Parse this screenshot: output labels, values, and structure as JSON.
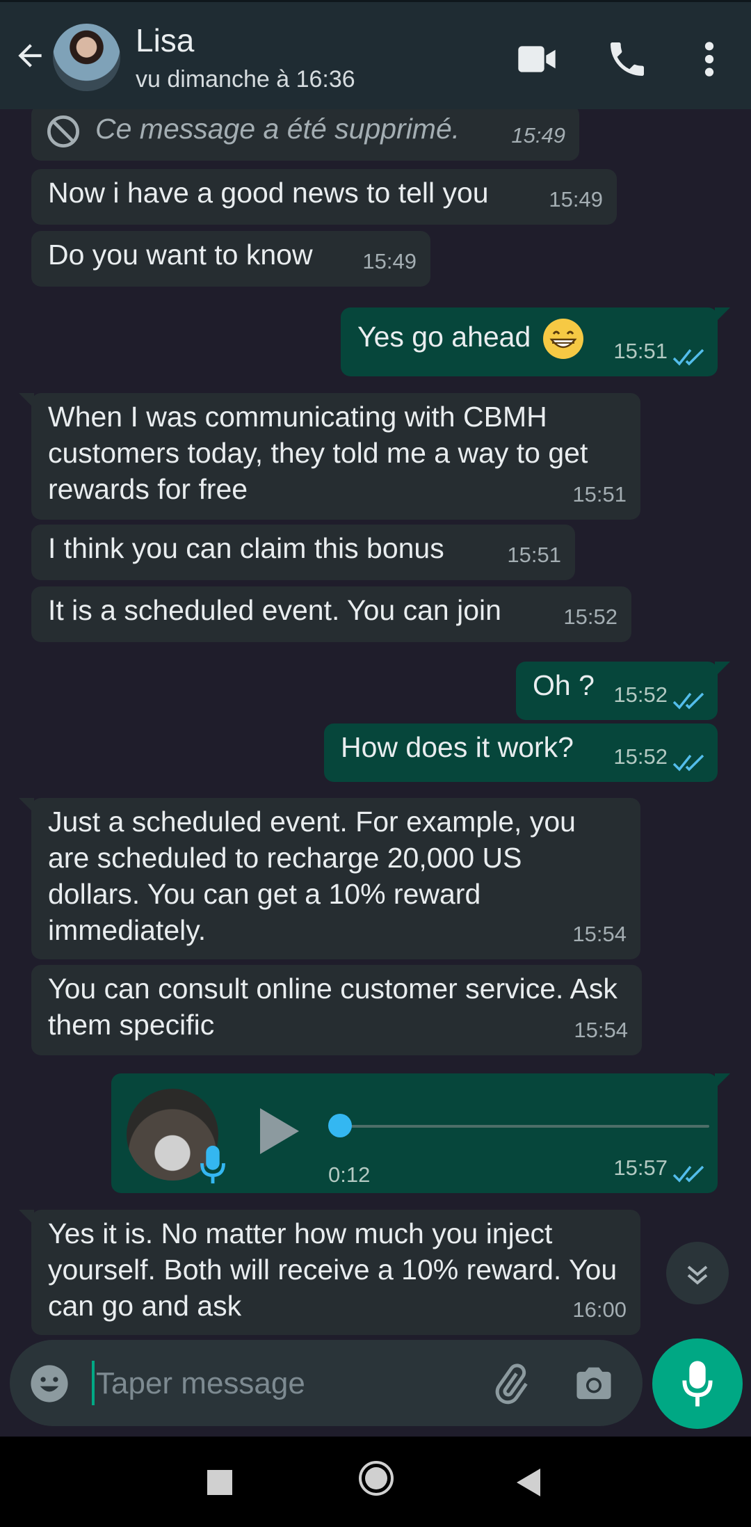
{
  "header": {
    "contact_name": "Lisa",
    "status": "vu dimanche à 16:36"
  },
  "messages": [
    {
      "dir": "in",
      "text": "Ce message a été supprimé.",
      "time": "15:49",
      "deleted": true
    },
    {
      "dir": "in",
      "text": "Now i have a good news to tell you",
      "time": "15:49"
    },
    {
      "dir": "in",
      "text": "Do you want to know",
      "time": "15:49"
    },
    {
      "dir": "out",
      "text": "Yes go ahead",
      "time": "15:51",
      "emoji": "grinning-face",
      "read": true
    },
    {
      "dir": "in",
      "text": "When I was communicating with CBMH customers today, they told me a way to get rewards for free",
      "time": "15:51"
    },
    {
      "dir": "in",
      "text": "I think you can claim this bonus",
      "time": "15:51"
    },
    {
      "dir": "in",
      "text": "It is a scheduled event. You can join",
      "time": "15:52"
    },
    {
      "dir": "out",
      "text": "Oh ?",
      "time": "15:52",
      "read": true
    },
    {
      "dir": "out",
      "text": "How does it work?",
      "time": "15:52",
      "read": true
    },
    {
      "dir": "in",
      "text": "Just a scheduled event. For example, you are scheduled to recharge 20,000 US dollars. You can get a 10% reward immediately.",
      "time": "15:54"
    },
    {
      "dir": "in",
      "text": "You can consult online customer service. Ask them specific",
      "time": "15:54"
    },
    {
      "dir": "out",
      "type": "voice",
      "duration": "0:12",
      "time": "15:57",
      "read": true,
      "progress": 0
    },
    {
      "dir": "in",
      "text": "Yes it is. No matter how much you inject yourself. Both will receive a 10% reward. You can go and ask",
      "time": "16:00"
    }
  ],
  "input": {
    "placeholder": "Taper message"
  },
  "colors": {
    "background": "#1f1d2b",
    "header": "#1f2c33",
    "incoming_bubble": "#262d31",
    "outgoing_bubble": "#06463b",
    "accent": "#00a884",
    "read_ticks": "#53bdeb"
  }
}
